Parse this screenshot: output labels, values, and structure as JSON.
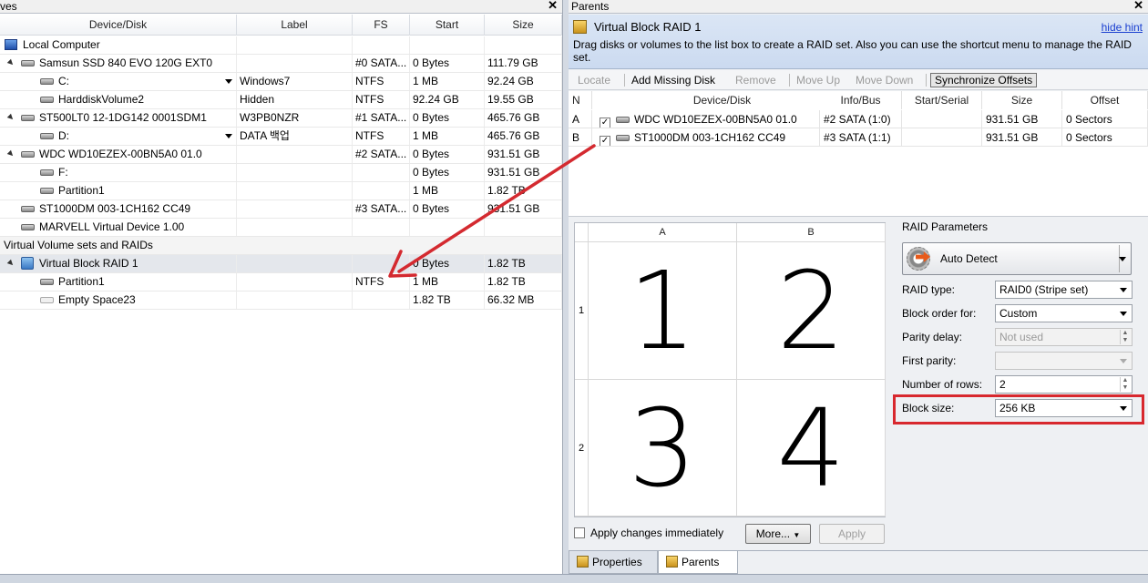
{
  "left": {
    "title": "ves",
    "close": "✕",
    "columns": [
      "Device/Disk",
      "Label",
      "FS",
      "Start",
      "Size"
    ],
    "rows": [
      {
        "name": "Local Computer",
        "label": "",
        "fs": "",
        "start": "",
        "size": ""
      },
      {
        "name": "Samsun SSD 840 EVO 120G EXT0",
        "label": "",
        "fs": "#0 SATA...",
        "start": "0 Bytes",
        "size": "111.79 GB"
      },
      {
        "name": "C:",
        "label": "Windows7",
        "fs": "NTFS",
        "start": "1 MB",
        "size": "92.24 GB"
      },
      {
        "name": "HarddiskVolume2",
        "label": "Hidden",
        "fs": "NTFS",
        "start": "92.24 GB",
        "size": "19.55 GB"
      },
      {
        "name": "ST500LT0 12-1DG142 0001SDM1",
        "label": "W3PB0NZR",
        "fs": "#1 SATA...",
        "start": "0 Bytes",
        "size": "465.76 GB"
      },
      {
        "name": "D:",
        "label": "DATA 백업",
        "fs": "NTFS",
        "start": "1 MB",
        "size": "465.76 GB"
      },
      {
        "name": "WDC WD10EZEX-00BN5A0 01.0",
        "label": "",
        "fs": "#2 SATA...",
        "start": "0 Bytes",
        "size": "931.51 GB"
      },
      {
        "name": "F:",
        "label": "",
        "fs": "",
        "start": "0 Bytes",
        "size": "931.51 GB"
      },
      {
        "name": "Partition1",
        "label": "",
        "fs": "",
        "start": "1 MB",
        "size": "1.82 TB"
      },
      {
        "name": "ST1000DM 003-1CH162 CC49",
        "label": "",
        "fs": "#3 SATA...",
        "start": "0 Bytes",
        "size": "931.51 GB"
      },
      {
        "name": "MARVELL Virtual Device 1.00",
        "label": "",
        "fs": "",
        "start": "",
        "size": ""
      },
      {
        "name": "Virtual Volume sets and RAIDs",
        "label": "",
        "fs": "",
        "start": "",
        "size": ""
      },
      {
        "name": "Virtual Block RAID 1",
        "label": "",
        "fs": "",
        "start": "0 Bytes",
        "size": "1.82 TB"
      },
      {
        "name": "Partition1",
        "label": "",
        "fs": "NTFS",
        "start": "1 MB",
        "size": "1.82 TB"
      },
      {
        "name": "Empty Space23",
        "label": "",
        "fs": "",
        "start": "1.82 TB",
        "size": "66.32 MB"
      }
    ]
  },
  "right": {
    "title": "Parents",
    "close": "✕",
    "raid_name": "Virtual Block RAID 1",
    "hide_hint": "hide hint",
    "hint": "Drag disks or volumes to the list box to create a RAID set. Also you can use the shortcut menu to manage the RAID set.",
    "toolbar": {
      "locate": "Locate",
      "add_missing": "Add Missing Disk",
      "remove": "Remove",
      "move_up": "Move Up",
      "move_down": "Move Down",
      "sync": "Synchronize Offsets"
    },
    "columns": [
      "N",
      "Device/Disk",
      "Info/Bus",
      "Start/Serial",
      "Size",
      "Offset"
    ],
    "parents": [
      {
        "n": "A",
        "checked": "✓",
        "device": "WDC WD10EZEX-00BN5A0 01.0",
        "info": "#2 SATA (1:0)",
        "start": "",
        "size": "931.51 GB",
        "offset": "0 Sectors"
      },
      {
        "n": "B",
        "checked": "✓",
        "device": "ST1000DM 003-1CH162 CC49",
        "info": "#3 SATA (1:1)",
        "start": "",
        "size": "931.51 GB",
        "offset": "0 Sectors"
      }
    ],
    "grid": {
      "cols": [
        "A",
        "B"
      ],
      "rows": [
        "1",
        "2"
      ],
      "cells": [
        "1",
        "2",
        "3",
        "4"
      ]
    },
    "params": {
      "heading": "RAID Parameters",
      "auto_detect": "Auto Detect",
      "raid_type_label": "RAID type:",
      "raid_type": "RAID0 (Stripe set)",
      "block_order_label": "Block order for:",
      "block_order": "Custom",
      "parity_delay_label": "Parity delay:",
      "parity_delay": "Not used",
      "first_parity_label": "First parity:",
      "first_parity": "",
      "rows_label": "Number of rows:",
      "rows": "2",
      "block_size_label": "Block size:",
      "block_size": "256 KB"
    },
    "apply_immediately": "Apply changes immediately",
    "more": "More...",
    "apply": "Apply",
    "tabs": [
      "Properties",
      "Parents"
    ]
  },
  "colors": {
    "highlight_box": "#d8282e",
    "arrow": "#d42a30"
  }
}
